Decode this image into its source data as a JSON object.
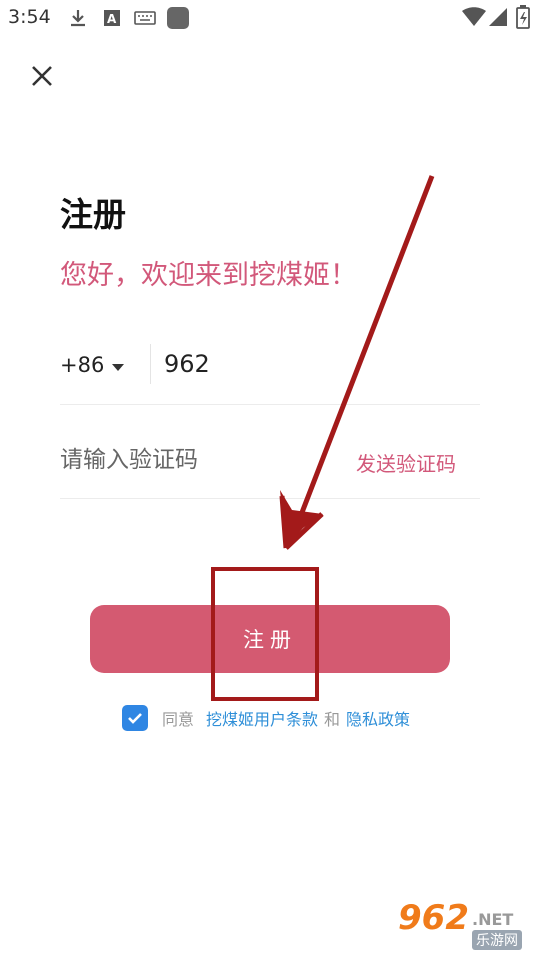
{
  "status_bar": {
    "time": "3:54",
    "icons": [
      "download-icon",
      "font-icon",
      "keyboard-icon",
      "app-square-icon",
      "wifi-icon",
      "signal-icon",
      "battery-icon"
    ]
  },
  "header": {
    "close_icon": "close-icon"
  },
  "title": "注册",
  "welcome": "您好，欢迎来到挖煤姬！",
  "phone": {
    "country_code": "+86",
    "value": "962"
  },
  "verify": {
    "placeholder": "请输入验证码",
    "send_label": "发送验证码"
  },
  "register_button": "注册",
  "agreement": {
    "checked": true,
    "prefix": "同意",
    "terms_link": "挖煤姬用户条款",
    "and": "和",
    "privacy_link": "隐私政策"
  },
  "watermark": {
    "number": "962",
    "net": ".NET",
    "cn": "乐游网"
  },
  "colors": {
    "accent": "#d45a71",
    "link": "#2f8fd8",
    "checkbox": "#2f86e3",
    "annotation": "#a31a1a"
  }
}
